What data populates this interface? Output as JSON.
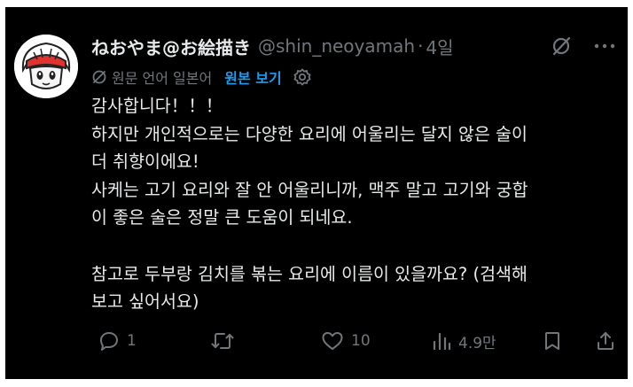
{
  "tweet": {
    "display_name": "ねおやま@お絵描き",
    "handle": "@shin_neoyamah",
    "separator": "·",
    "time": "4일",
    "translation": {
      "label": "원문 언어 일본어",
      "show_original": "원본 보기"
    },
    "lines": [
      "감사합니다！！！",
      "하지만 개인적으로는 다양한 요리에 어울리는 달지 않은 술이",
      "더 취향이에요!",
      "사케는 고기 요리와 잘 안 어울리니까, 맥주 말고 고기와 궁합",
      "이 좋은 술은 정말 큰 도움이 되네요.",
      "",
      "참고로 두부랑 김치를 볶는 요리에 이름이 있을까요? (검색해",
      "보고 싶어서요)"
    ]
  },
  "actions": {
    "reply_count": "1",
    "retweet_count": "",
    "like_count": "10",
    "views_count": "4.9만"
  },
  "icons": [
    "grok-icon",
    "more-icon",
    "translate-icon",
    "gear-icon",
    "reply-icon",
    "retweet-icon",
    "like-icon",
    "views-icon",
    "bookmark-icon",
    "share-icon"
  ],
  "colors": {
    "background": "#000000",
    "text": "#e7e9ea",
    "muted": "#71767b",
    "link": "#1d9bf0"
  }
}
